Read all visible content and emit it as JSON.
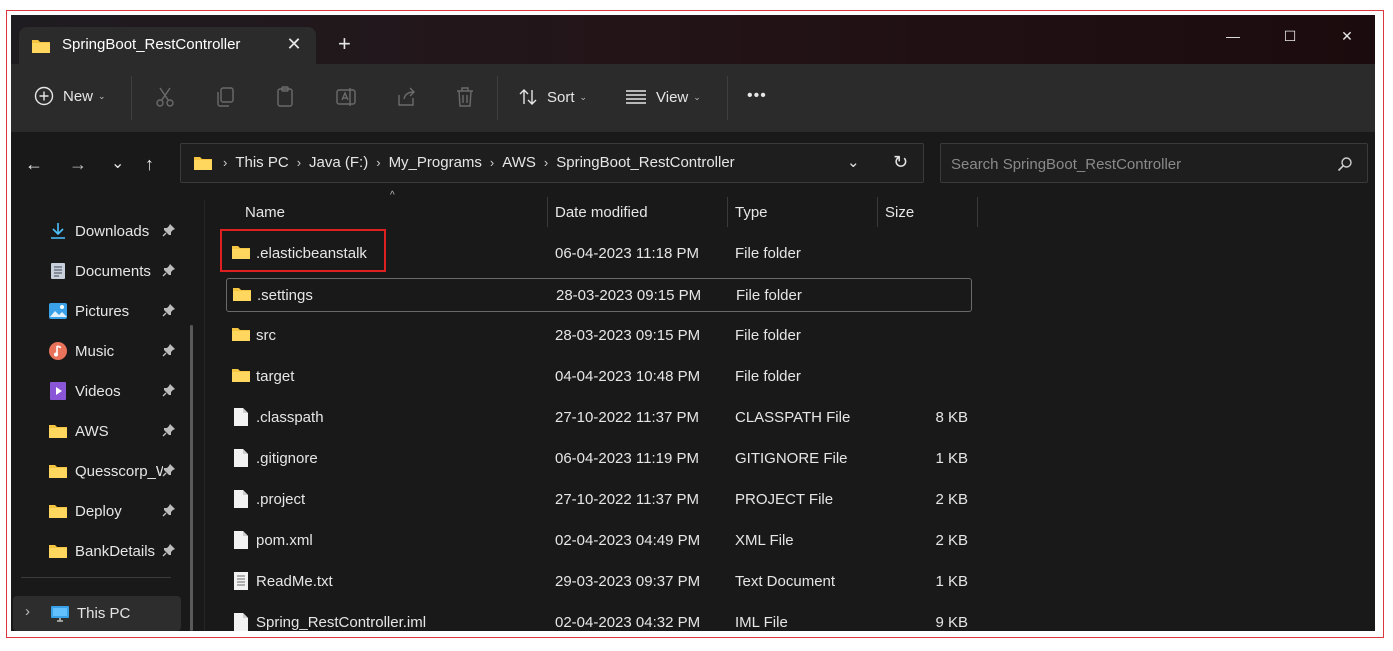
{
  "window": {
    "tab_title": "SpringBoot_RestController",
    "tab_close": "✕",
    "new_tab": "+",
    "controls": {
      "minimize": "—",
      "maximize": "☐",
      "close": "✕"
    }
  },
  "toolbar": {
    "new_label": "New",
    "sort_label": "Sort",
    "view_label": "View",
    "more_label": "•••",
    "dropdown_glyph": "⌄"
  },
  "address": {
    "back": "←",
    "forward": "→",
    "recent": "⌄",
    "up": "↑",
    "breadcrumb": [
      "This PC",
      "Java (F:)",
      "My_Programs",
      "AWS",
      "SpringBoot_RestController"
    ],
    "separator": "›",
    "history_dropdown": "⌄",
    "refresh": "↻"
  },
  "search": {
    "placeholder": "Search SpringBoot_RestController"
  },
  "sidebar": {
    "items": [
      {
        "label": "Downloads",
        "icon": "download-icon"
      },
      {
        "label": "Documents",
        "icon": "documents-icon"
      },
      {
        "label": "Pictures",
        "icon": "pictures-icon"
      },
      {
        "label": "Music",
        "icon": "music-icon"
      },
      {
        "label": "Videos",
        "icon": "videos-icon"
      },
      {
        "label": "AWS",
        "icon": "folder-icon"
      },
      {
        "label": "Quesscorp_W",
        "icon": "folder-icon"
      },
      {
        "label": "Deploy",
        "icon": "folder-icon"
      },
      {
        "label": "BankDetails",
        "icon": "folder-icon"
      }
    ],
    "this_pc": "This PC",
    "expand_glyph": "›"
  },
  "columns": {
    "name": "Name",
    "date": "Date modified",
    "type": "Type",
    "size": "Size",
    "sort_indicator": "^"
  },
  "files": [
    {
      "name": ".elasticbeanstalk",
      "date": "06-04-2023 11:18 PM",
      "type": "File folder",
      "size": "",
      "kind": "folder"
    },
    {
      "name": ".settings",
      "date": "28-03-2023 09:15 PM",
      "type": "File folder",
      "size": "",
      "kind": "folder"
    },
    {
      "name": "src",
      "date": "28-03-2023 09:15 PM",
      "type": "File folder",
      "size": "",
      "kind": "folder"
    },
    {
      "name": "target",
      "date": "04-04-2023 10:48 PM",
      "type": "File folder",
      "size": "",
      "kind": "folder"
    },
    {
      "name": ".classpath",
      "date": "27-10-2022 11:37 PM",
      "type": "CLASSPATH File",
      "size": "8 KB",
      "kind": "file"
    },
    {
      "name": ".gitignore",
      "date": "06-04-2023 11:19 PM",
      "type": "GITIGNORE File",
      "size": "1 KB",
      "kind": "file"
    },
    {
      "name": ".project",
      "date": "27-10-2022 11:37 PM",
      "type": "PROJECT File",
      "size": "2 KB",
      "kind": "file"
    },
    {
      "name": "pom.xml",
      "date": "02-04-2023 04:49 PM",
      "type": "XML File",
      "size": "2 KB",
      "kind": "file"
    },
    {
      "name": "ReadMe.txt",
      "date": "29-03-2023 09:37 PM",
      "type": "Text Document",
      "size": "1 KB",
      "kind": "text"
    },
    {
      "name": "Spring_RestController.iml",
      "date": "02-04-2023 04:32 PM",
      "type": "IML File",
      "size": "9 KB",
      "kind": "file"
    }
  ],
  "colors": {
    "folder": "#f5c542",
    "accent": "#4cc2ff",
    "highlight": "#e02020"
  }
}
